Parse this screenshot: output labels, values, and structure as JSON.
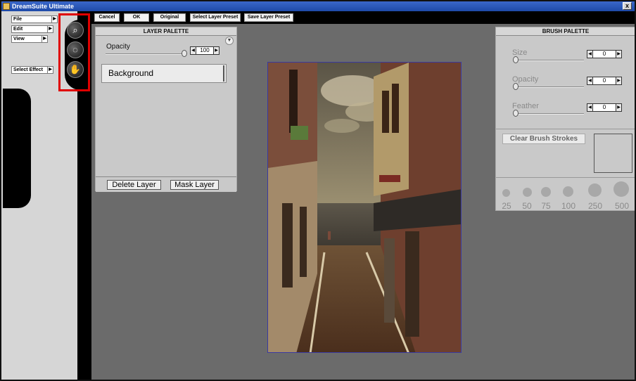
{
  "window": {
    "title": "DreamSuite Ultimate",
    "close_glyph": "x"
  },
  "toolbar": {
    "cancel_label": "Cancel",
    "ok_label": "OK",
    "original_label": "Original",
    "select_preset_label": "Select Layer Preset",
    "save_preset_label": "Save Layer Preset"
  },
  "menu": {
    "file": "File",
    "edit": "Edit",
    "view": "View",
    "select_effect": "Select Effect",
    "arrow": "▶"
  },
  "tools": {
    "zoom_glyph": "⌕",
    "selection_glyph": "◌",
    "hand_glyph": "✋"
  },
  "layer_palette": {
    "title": "LAYER PALETTE",
    "opacity_label": "Opacity",
    "opacity_value": "100",
    "stepper_left": "◀",
    "stepper_right": "▶",
    "layers": [
      "Background"
    ],
    "delete_label": "Delete Layer",
    "mask_label": "Mask Layer"
  },
  "brush_palette": {
    "title": "BRUSH PALETTE",
    "size_label": "Size",
    "size_value": "0",
    "opacity_label": "Opacity",
    "opacity_value": "0",
    "feather_label": "Feather",
    "feather_value": "0",
    "clear_label": "Clear Brush Strokes",
    "brush_sizes": [
      "25",
      "50",
      "75",
      "100",
      "250",
      "500"
    ]
  },
  "colors": {
    "titlebar": "#1e4aa8",
    "highlight_box": "#e00000",
    "workspace": "#6b6b6b",
    "palette_bg": "#c9c9c9"
  }
}
